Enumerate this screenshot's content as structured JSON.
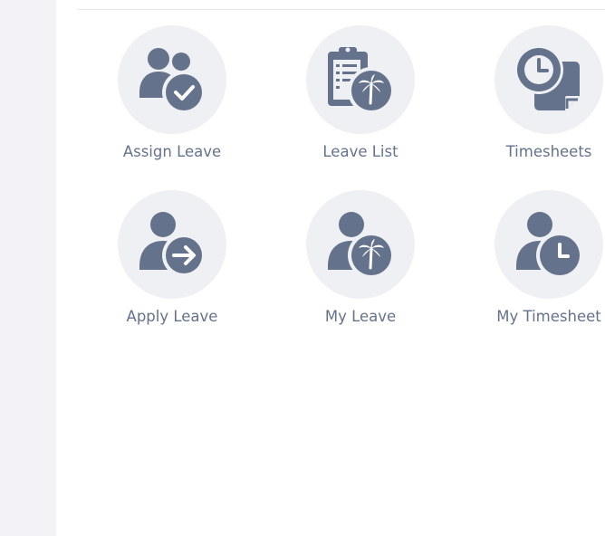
{
  "quick_launch": {
    "items": [
      {
        "label": "Assign Leave",
        "icon": "assign-leave-icon"
      },
      {
        "label": "Leave List",
        "icon": "leave-list-icon"
      },
      {
        "label": "Timesheets",
        "icon": "timesheets-icon"
      },
      {
        "label": "Apply Leave",
        "icon": "apply-leave-icon"
      },
      {
        "label": "My Leave",
        "icon": "my-leave-icon"
      },
      {
        "label": "My Timesheet",
        "icon": "my-timesheet-icon"
      }
    ]
  },
  "colors": {
    "icon": "#64728c",
    "circle_bg": "#eef0f3",
    "sidebar_bg": "#f2f2f7",
    "label": "#64728c"
  }
}
